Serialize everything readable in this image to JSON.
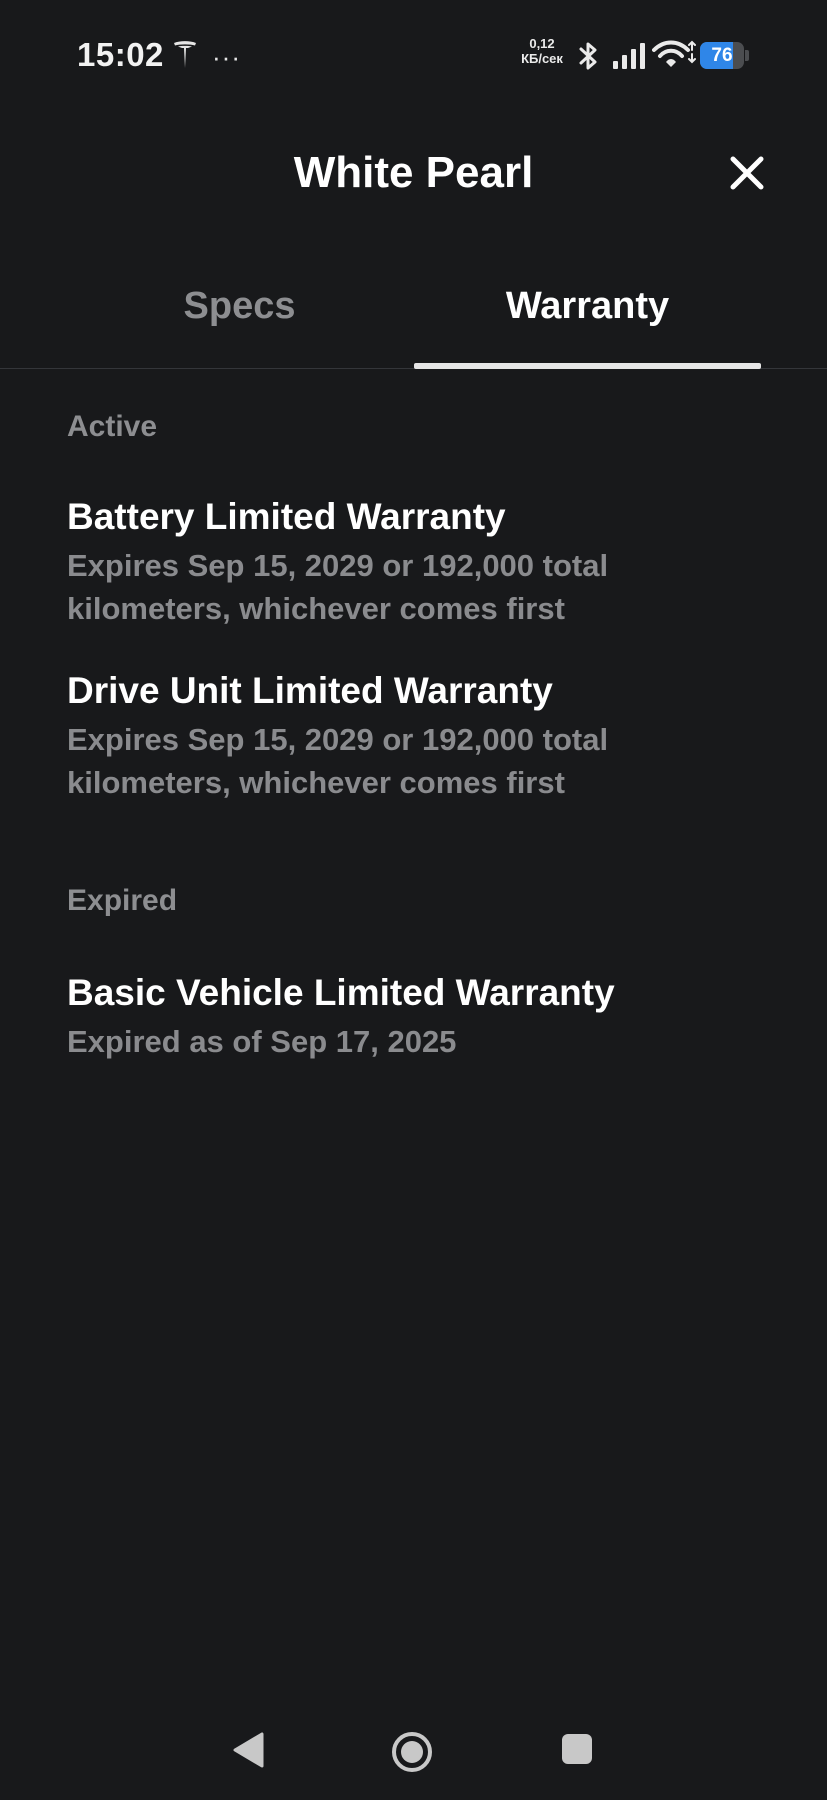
{
  "status_bar": {
    "time": "15:02",
    "more": "···",
    "net_speed_value": "0,12",
    "net_speed_unit": "КБ/сек",
    "battery_level": "76",
    "battery_fraction": 0.76,
    "icons": [
      "tesla-icon",
      "more-icon",
      "bluetooth-icon",
      "signal-icon",
      "wifi-icon",
      "battery-icon"
    ]
  },
  "header": {
    "title": "White Pearl",
    "close_icon": "close-icon"
  },
  "tabs": [
    {
      "label": "Specs",
      "active": false
    },
    {
      "label": "Warranty",
      "active": true
    }
  ],
  "sections": {
    "active": {
      "title": "Active",
      "items": [
        {
          "name": "Battery Limited Warranty",
          "description": "Expires Sep 15, 2029 or 192,000 total kilometers, whichever comes first"
        },
        {
          "name": "Drive Unit Limited Warranty",
          "description": "Expires Sep 15, 2029 or 192,000 total kilometers, whichever comes first"
        }
      ]
    },
    "expired": {
      "title": "Expired",
      "items": [
        {
          "name": "Basic Vehicle Limited Warranty",
          "description": "Expired as of Sep 17, 2025"
        }
      ]
    }
  },
  "nav_bar": {
    "icons": [
      "back-icon",
      "home-icon",
      "recents-icon"
    ]
  },
  "colors": {
    "background": "#18191b",
    "primary_text": "#ffffff",
    "secondary_text": "#8a8b8e",
    "battery_accent": "#2f86e8"
  }
}
